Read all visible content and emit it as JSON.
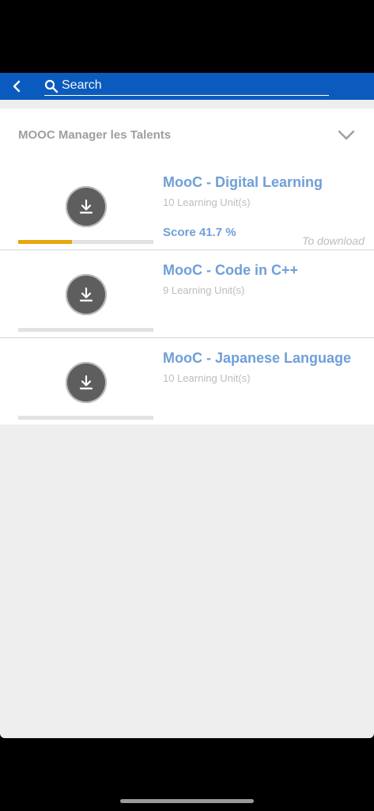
{
  "search": {
    "placeholder": "Search",
    "value": ""
  },
  "section": {
    "title": "MOOC Manager les Talents"
  },
  "courses": [
    {
      "title": "MooC - Digital Learning",
      "units": "10 Learning Unit(s)",
      "score": "Score 41.7 %",
      "status": "To download",
      "progress": 0.4
    },
    {
      "title": "MooC - Code in C++",
      "units": "9 Learning Unit(s)",
      "score": "",
      "status": "",
      "progress": 0
    },
    {
      "title": "MooC - Japanese Language",
      "units": "10 Learning Unit(s)",
      "score": "",
      "status": "",
      "progress": 0
    }
  ],
  "colors": {
    "header": "#0a5bbd",
    "accent_text": "#6f9fd8",
    "progress_fill": "#e8a70c",
    "progress_track": "#e2e2e2",
    "download_button": "#5e5e5e"
  },
  "icons": {
    "back": "chevron-left-icon",
    "search": "search-icon",
    "expand": "chevron-down-icon",
    "download": "download-icon"
  }
}
